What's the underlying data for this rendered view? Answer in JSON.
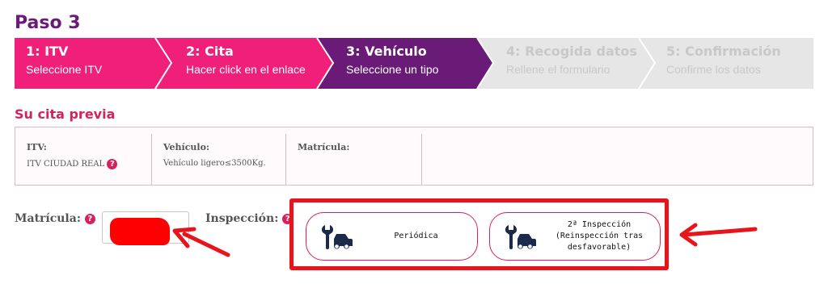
{
  "page": {
    "step_title": "Paso 3"
  },
  "steps": [
    {
      "num": "1: ITV",
      "sub": "Seleccione ITV",
      "state": "done"
    },
    {
      "num": "2: Cita",
      "sub": "Hacer click en el enlace",
      "state": "done"
    },
    {
      "num": "3: Vehículo",
      "sub": "Seleccione un tipo",
      "state": "active"
    },
    {
      "num": "4: Recogida datos",
      "sub": "Rellene el formulario",
      "state": "pending"
    },
    {
      "num": "5: Confirmación",
      "sub": "Confirme los datos",
      "state": "pending"
    }
  ],
  "summary": {
    "title": "Su cita previa",
    "itv_label": "ITV:",
    "itv_value": "ITV CIUDAD REAL",
    "vehicle_label": "Vehículo:",
    "vehicle_value": "Vehículo ligero≤3500Kg.",
    "plate_label": "Matrícula:"
  },
  "form": {
    "plate_label": "Matrícula:",
    "inspection_label": "Inspección:",
    "help_glyph": "?",
    "options": [
      {
        "label": "Periódica"
      },
      {
        "label_lines": [
          "2ª Inspección",
          "(Reinspección tras",
          "desfavorable)"
        ]
      }
    ]
  },
  "colors": {
    "done": "#f0207a",
    "active": "#6a1b78",
    "pending": "#e6e6e6",
    "accent": "#d4215f",
    "annotation": "#e8141b"
  },
  "icons": [
    "help-icon",
    "wrench-car-icon",
    "arrow-icon"
  ]
}
